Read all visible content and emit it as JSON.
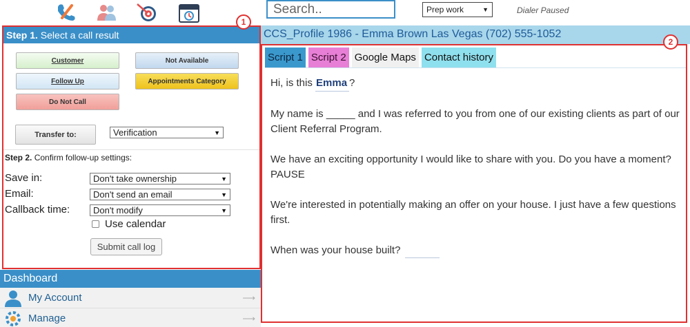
{
  "toolbar": {
    "icons": [
      "phone-icon",
      "contacts-icon",
      "target-icon",
      "calendar-icon"
    ]
  },
  "search": {
    "placeholder": "Search.."
  },
  "status_select": {
    "value": "Prep work"
  },
  "dialer_status": "Dialer Paused",
  "profile": {
    "title": "CCS_Profile 1986 - Emma Brown Las Vegas (702) 555-1052"
  },
  "step1": {
    "prefix": "Step 1.",
    "text": "Select a call result",
    "badge": "1",
    "buttons": {
      "customer": "Customer",
      "not_available": "Not Available",
      "follow_up": "Follow Up",
      "appointments": "Appointments Category",
      "do_not_call": "Do Not Call"
    },
    "transfer_label": "Transfer to:",
    "transfer_value": "Verification"
  },
  "step2": {
    "prefix": "Step 2.",
    "text": "Confirm follow-up settings:",
    "save_in_label": "Save in:",
    "save_in_value": "Don't take ownership",
    "email_label": "Email:",
    "email_value": "Don't send an email",
    "callback_label": "Callback time:",
    "callback_value": "Don't modify",
    "use_calendar_label": "Use calendar",
    "submit_label": "Submit call log"
  },
  "dashboard": {
    "title": "Dashboard",
    "items": [
      {
        "label": "My Account"
      },
      {
        "label": "Manage"
      }
    ]
  },
  "script": {
    "badge": "2",
    "tabs": [
      "Script 1",
      "Script 2",
      "Google Maps",
      "Contact history"
    ],
    "greeting_pre": "Hi, is this",
    "contact_name": "Emma",
    "greeting_post": "?",
    "p2": "My name is _____ and I was referred to you from one of our existing clients as part of our Client Referral Program.",
    "p3": "We have an exciting opportunity I would like to share with you. Do you have a moment? PAUSE",
    "p4": "We're interested in potentially making an offer on your house. I just have a few questions first.",
    "p5": "When was your house built?"
  },
  "colors": {
    "accent_blue": "#3a8fc8",
    "profile_bar": "#a8d6ea",
    "highlight_red": "#e03030",
    "customer_btn": "#e0f5d8",
    "not_available_btn": "#cfe0f0",
    "follow_up_btn": "#dcecf8",
    "appointments_btn": "#f3cf2a",
    "do_not_call_btn": "#f4a9a4",
    "tab_script1": "#3a98cc",
    "tab_script2": "#e77fd6",
    "tab_google_maps": "#f0f0f0",
    "tab_contact_history": "#8fe0ee"
  }
}
